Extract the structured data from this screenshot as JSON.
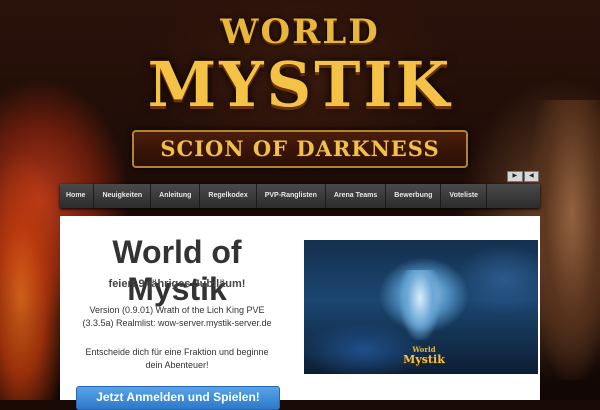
{
  "logo": {
    "line1": "WORLD",
    "line2": "MYSTIK",
    "banner": "SCION OF DARKNESS"
  },
  "media": {
    "play": "▶",
    "mute": "◀"
  },
  "nav": {
    "items": [
      {
        "label": "Home"
      },
      {
        "label": "Neuigkeiten"
      },
      {
        "label": "Anleitung"
      },
      {
        "label": "Regelkodex"
      },
      {
        "label": "PVP-Ranglisten"
      },
      {
        "label": "Arena Teams"
      },
      {
        "label": "Bewerbung"
      },
      {
        "label": "Voteliste"
      }
    ]
  },
  "content": {
    "title": "World of Mystik",
    "subtitle": "feiert 9-jähriges Jubiläum!",
    "version_line1": "Version (0.9.01) Wrath of the Lich King PVE",
    "version_line2": "(3.3.5a) Realmlist: wow-server.mystik-server.de",
    "cta_line1": "Entscheide dich für eine Fraktion und beginne",
    "cta_line2": "dein Abenteuer!",
    "button": "Jetzt Anmelden und Spielen!"
  },
  "artwork": {
    "logo_line1": "World",
    "logo_line2": "Mystik"
  }
}
